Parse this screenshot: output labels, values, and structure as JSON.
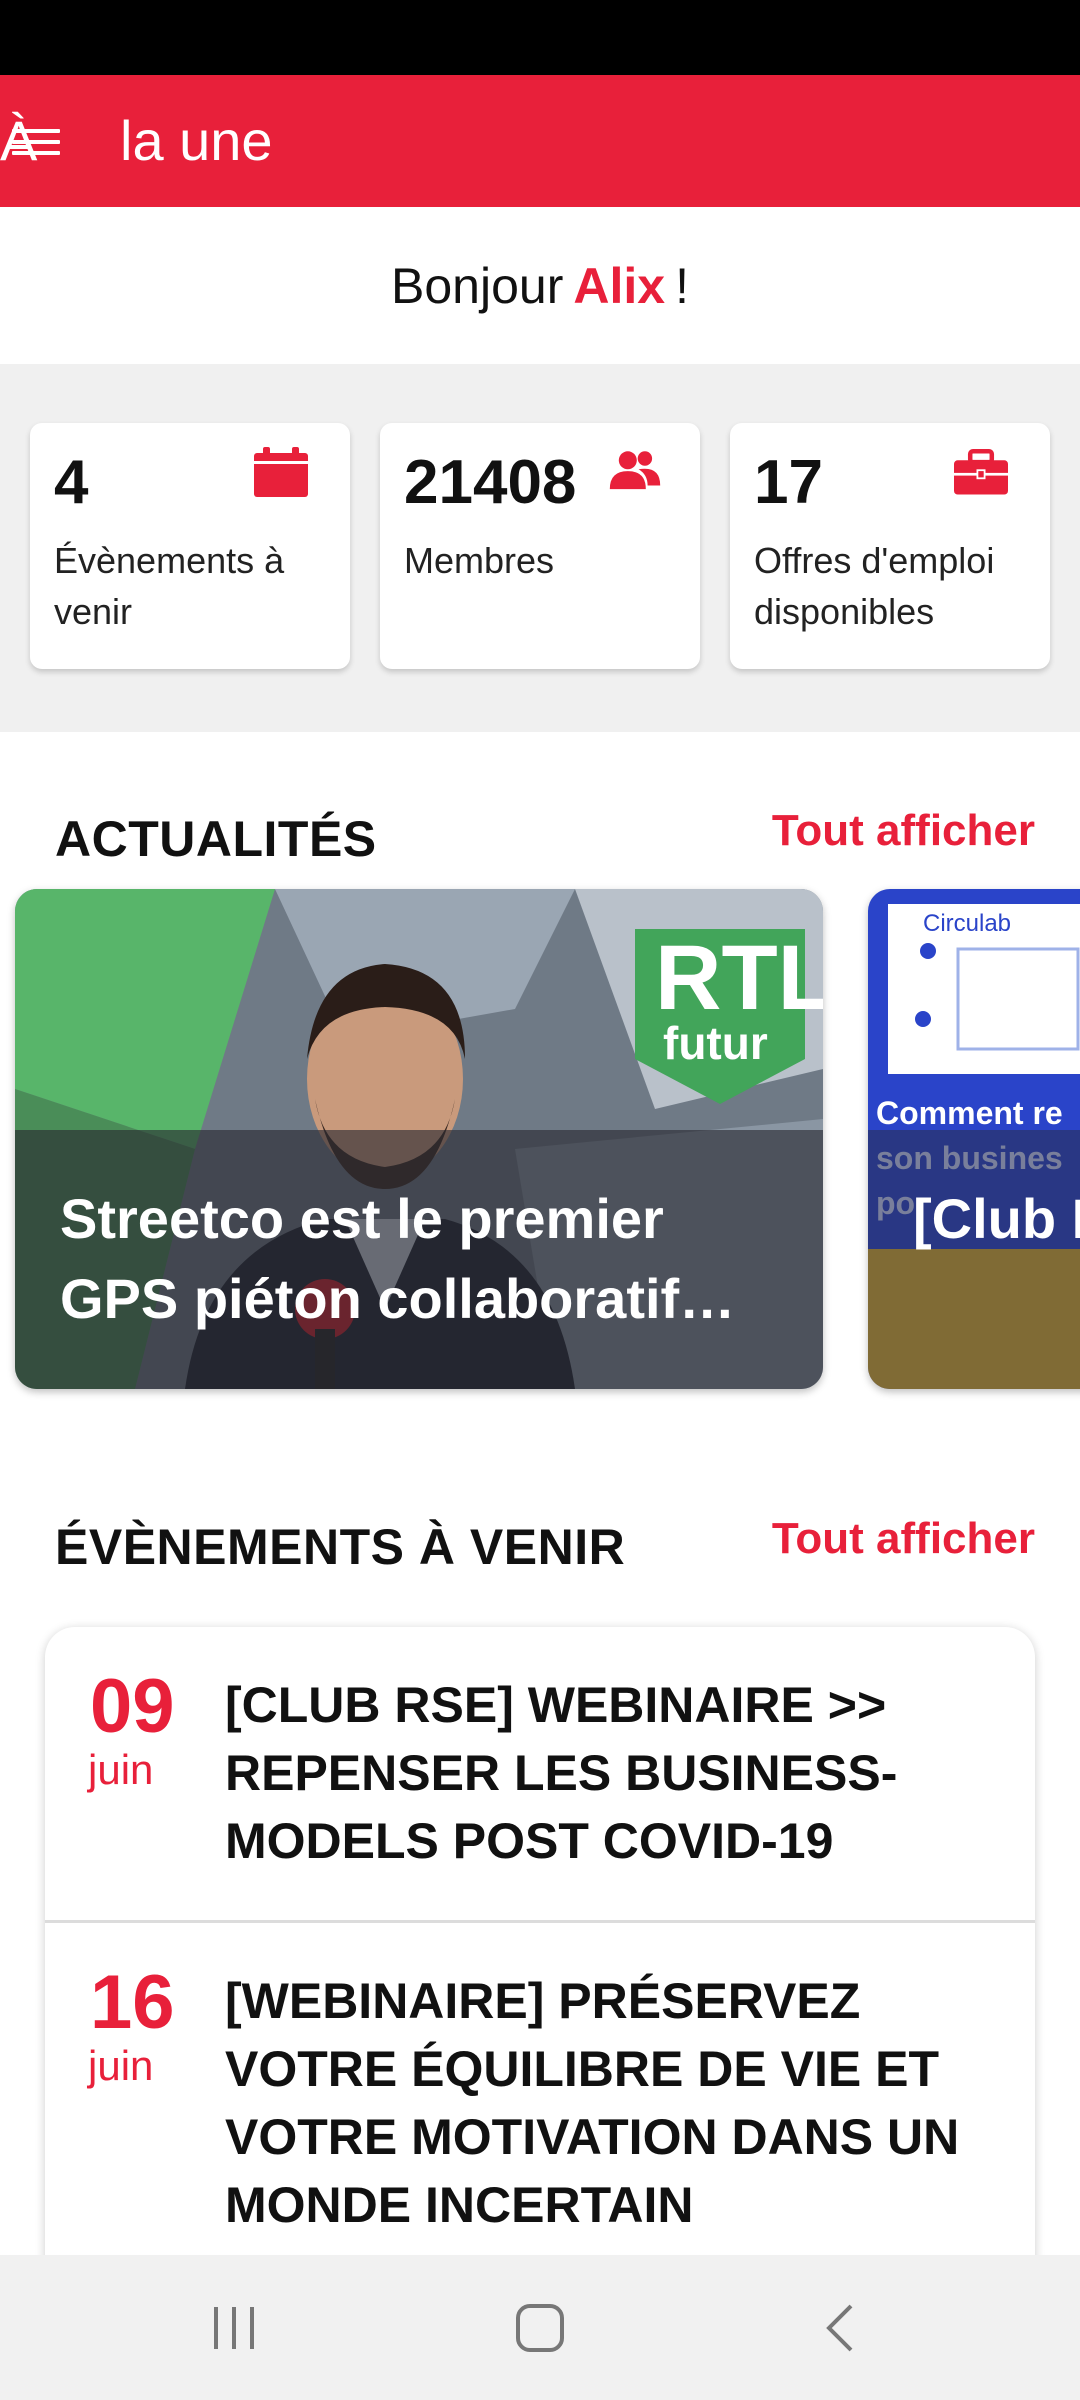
{
  "app_bar": {
    "menu_glyph": "À",
    "title": "la une"
  },
  "greeting": {
    "prefix": "Bonjour",
    "name": "Alix",
    "suffix": "!"
  },
  "stats": [
    {
      "value": "4",
      "label_line1": "Évènements à",
      "label_line2": "venir",
      "icon": "calendar-icon"
    },
    {
      "value": "21408",
      "label_line1": "Membres",
      "label_line2": "",
      "icon": "users-icon"
    },
    {
      "value": "17",
      "label_line1": "Offres d'emploi",
      "label_line2": "disponibles",
      "icon": "briefcase-icon"
    }
  ],
  "news": {
    "heading": "ACTUALITÉS",
    "view_all": "Tout afficher",
    "items": [
      {
        "title": "Streetco est le premier GPS piéton collaboratif…",
        "image_logo": "RTL futur"
      },
      {
        "title": "[Club RSE] Repen",
        "image_logo": "Circulab",
        "image_text": "Comment re son busines po"
      }
    ]
  },
  "events": {
    "heading": "ÉVÈNEMENTS À VENIR",
    "view_all": "Tout afficher",
    "items": [
      {
        "day": "09",
        "month": "juin",
        "title": "[CLUB RSE] WEBINAIRE >> REPENSER LES BUSINESS-MODELS POST COVID-19"
      },
      {
        "day": "16",
        "month": "juin",
        "title": "[WEBINAIRE] PRÉSERVEZ VOTRE ÉQUILIBRE DE VIE ET VOTRE MOTIVATION DANS UN MONDE INCERTAIN"
      }
    ]
  },
  "colors": {
    "accent": "#e8203a",
    "background_gray": "#f0f0f0",
    "nav_bar": "#f1f1f1"
  },
  "nav_buttons": [
    "recent-apps-icon",
    "home-icon",
    "back-icon"
  ]
}
